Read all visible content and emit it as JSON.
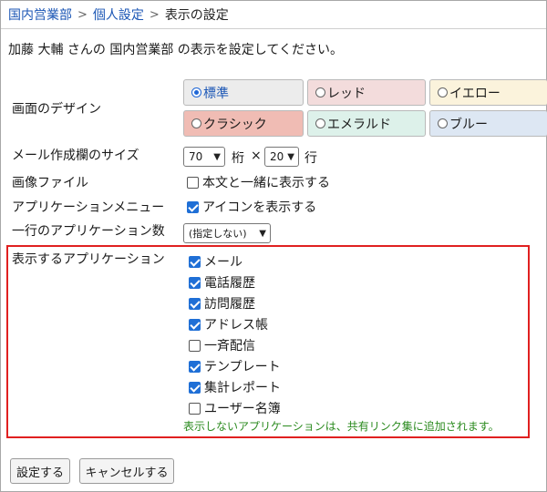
{
  "breadcrumb": {
    "items": [
      "国内営業部",
      "個人設定"
    ],
    "separator": ">",
    "current": "表示の設定"
  },
  "intro": "加藤 大輔 さんの 国内営業部 の表示を設定してください。",
  "design": {
    "label": "画面のデザイン",
    "options": [
      {
        "label": "標準",
        "selected": true,
        "bg": "#ececec"
      },
      {
        "label": "レッド",
        "selected": false,
        "bg": "#f3dcdc"
      },
      {
        "label": "イエロー",
        "selected": false,
        "bg": "#fbf3dc"
      },
      {
        "label": "クラシック",
        "selected": false,
        "bg": "#f0bcb4"
      },
      {
        "label": "エメラルド",
        "selected": false,
        "bg": "#ddf1ea"
      },
      {
        "label": "ブルー",
        "selected": false,
        "bg": "#dde7f3"
      }
    ]
  },
  "mail_size": {
    "label": "メール作成欄のサイズ",
    "cols_value": "70",
    "cols_unit": "桁",
    "times": "×",
    "rows_value": "20",
    "rows_unit": "行"
  },
  "image_file": {
    "label": "画像ファイル",
    "option": "本文と一緒に表示する",
    "checked": false
  },
  "app_menu": {
    "label": "アプリケーションメニュー",
    "option": "アイコンを表示する",
    "checked": true
  },
  "apps_per_row": {
    "label": "一行のアプリケーション数",
    "value": "(指定しない)"
  },
  "apps": {
    "label": "表示するアプリケーション",
    "items": [
      {
        "label": "メール",
        "checked": true
      },
      {
        "label": "電話履歴",
        "checked": true
      },
      {
        "label": "訪問履歴",
        "checked": true
      },
      {
        "label": "アドレス帳",
        "checked": true
      },
      {
        "label": "一斉配信",
        "checked": false
      },
      {
        "label": "テンプレート",
        "checked": true
      },
      {
        "label": "集計レポート",
        "checked": true
      },
      {
        "label": "ユーザー名簿",
        "checked": false
      }
    ],
    "note": "表示しないアプリケーションは、共有リンク集に追加されます。"
  },
  "buttons": {
    "save": "設定する",
    "cancel": "キャンセルする"
  },
  "colors": {
    "link": "#1b56b5",
    "highlight_border": "#e02020",
    "note_text": "#2a8a1e",
    "checkbox_checked": "#1f6fd6"
  }
}
